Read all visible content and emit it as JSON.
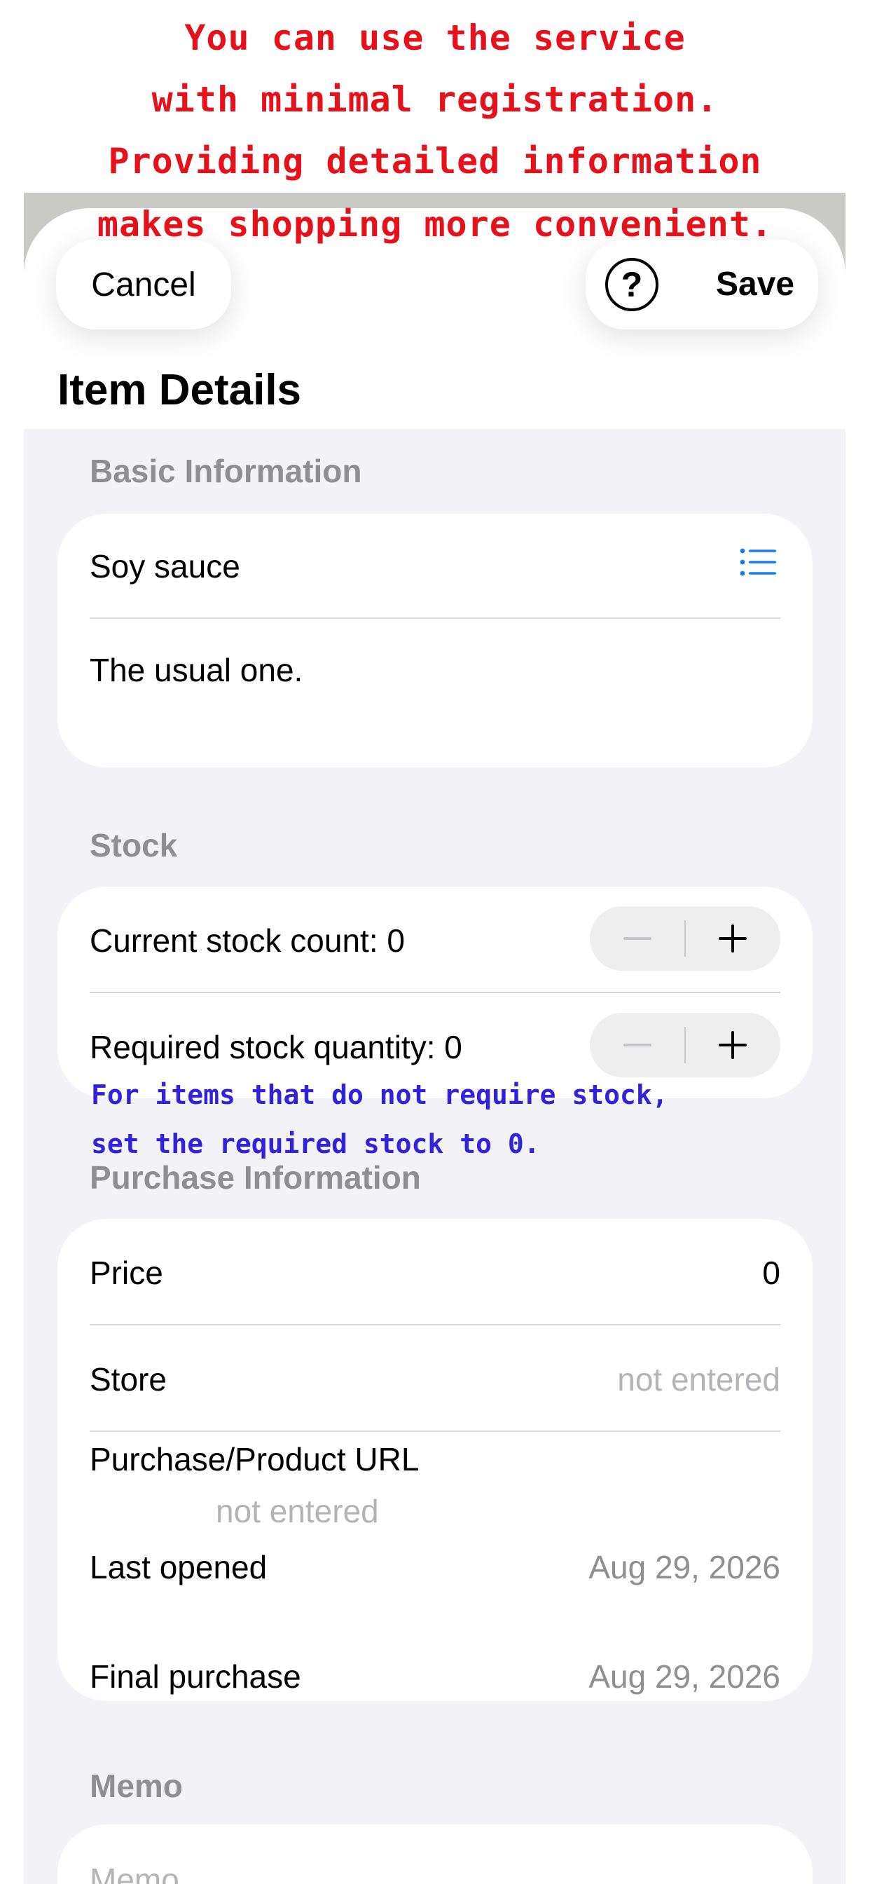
{
  "annotations": {
    "top": [
      "You can use the service",
      "with minimal registration.",
      "Providing detailed information",
      "makes shopping more convenient."
    ],
    "stock_hint": [
      "For items that do not require stock,",
      "set the required stock to 0."
    ]
  },
  "header": {
    "cancel_label": "Cancel",
    "help_icon": "question-circle-icon",
    "help_glyph": "?",
    "save_label": "Save",
    "title": "Item Details"
  },
  "basic": {
    "section_title": "Basic Information",
    "name_value": "Soy sauce",
    "list_icon": "list-bullet-icon",
    "accent": "#1a7cf0",
    "description_value": "The usual one."
  },
  "stock": {
    "section_title": "Stock",
    "current_label": "Current stock count: 0",
    "required_label": "Required stock quantity: 0"
  },
  "purchase": {
    "section_title": "Purchase Information",
    "price_label": "Price",
    "price_value": "0",
    "store_label": "Store",
    "store_placeholder": "not entered",
    "url_label": "Purchase/Product URL",
    "url_placeholder": "not entered",
    "last_opened_label": "Last opened",
    "last_opened_value": "Aug 29, 2026",
    "final_purchase_label": "Final purchase",
    "final_purchase_value": "Aug 29, 2026"
  },
  "memo": {
    "section_title": "Memo",
    "placeholder": "Memo"
  }
}
